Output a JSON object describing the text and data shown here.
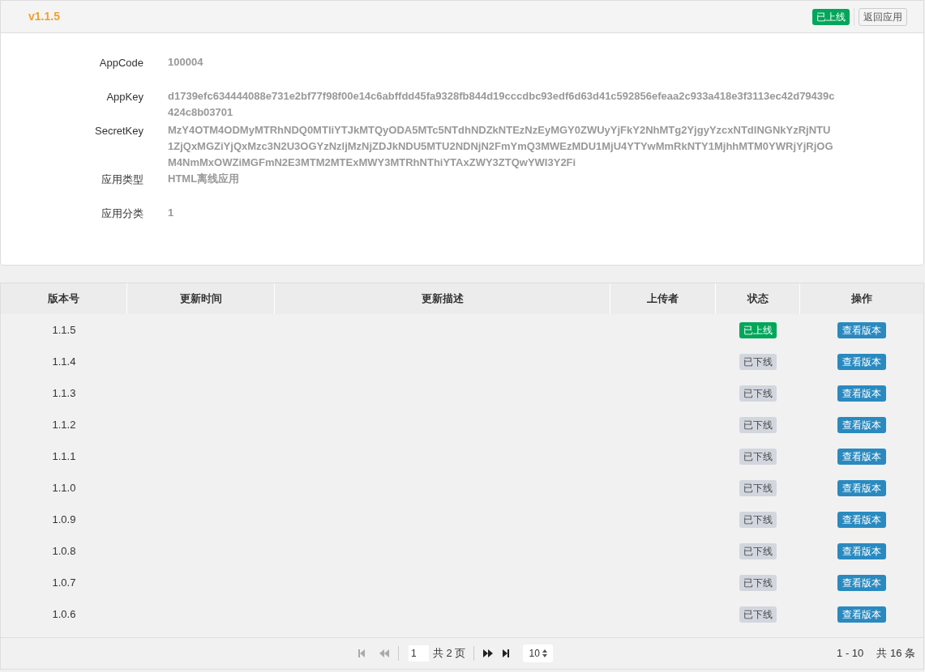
{
  "header": {
    "version": "v1.1.5",
    "status": {
      "label": "已上线",
      "kind": "online"
    },
    "back_button": "返回应用"
  },
  "fields": [
    {
      "label": "AppCode",
      "value": "100004"
    },
    {
      "label": "AppKey",
      "value": "d1739efc634444088e731e2bf77f98f00e14c6abffdd45fa9328fb844d19cccdbc93edf6d63d41c592856efeaa2c933a418e3f3113ec42d79439c424c8b03701"
    },
    {
      "label": "SecretKey",
      "value": "MzY4OTM4ODMyMTRhNDQ0MTliYTJkMTQyODA5MTc5NTdhNDZkNTEzNzEyMGY0ZWUyYjFkY2NhMTg2YjgyYzcxNTdlNGNkYzRjNTU1ZjQxMGZiYjQxMzc3N2U3OGYzNzljMzNjZDJkNDU5MTU2NDNjN2FmYmQ3MWEzMDU1MjU4YTYwMmRkNTY1MjhhMTM0YWRjYjRjOGM4NmMxOWZiMGFmN2E3MTM2MTExMWY3MTRhNThiYTAxZWY3ZTQwYWI3Y2Fi"
    },
    {
      "label": "应用类型",
      "value": "HTML离线应用"
    },
    {
      "label": "应用分类",
      "value": "1"
    }
  ],
  "table": {
    "columns": [
      "版本号",
      "更新时间",
      "更新描述",
      "上传者",
      "状态",
      "操作"
    ],
    "rows": [
      {
        "version": "1.1.5",
        "status": {
          "label": "已上线",
          "kind": "online"
        },
        "action": "查看版本"
      },
      {
        "version": "1.1.4",
        "status": {
          "label": "已下线",
          "kind": "offline"
        },
        "action": "查看版本"
      },
      {
        "version": "1.1.3",
        "status": {
          "label": "已下线",
          "kind": "offline"
        },
        "action": "查看版本"
      },
      {
        "version": "1.1.2",
        "status": {
          "label": "已下线",
          "kind": "offline"
        },
        "action": "查看版本"
      },
      {
        "version": "1.1.1",
        "status": {
          "label": "已下线",
          "kind": "offline"
        },
        "action": "查看版本"
      },
      {
        "version": "1.1.0",
        "status": {
          "label": "已下线",
          "kind": "offline"
        },
        "action": "查看版本"
      },
      {
        "version": "1.0.9",
        "status": {
          "label": "已下线",
          "kind": "offline"
        },
        "action": "查看版本"
      },
      {
        "version": "1.0.8",
        "status": {
          "label": "已下线",
          "kind": "offline"
        },
        "action": "查看版本"
      },
      {
        "version": "1.0.7",
        "status": {
          "label": "已下线",
          "kind": "offline"
        },
        "action": "查看版本"
      },
      {
        "version": "1.0.6",
        "status": {
          "label": "已下线",
          "kind": "offline"
        },
        "action": "查看版本"
      }
    ]
  },
  "pager": {
    "first_disabled": true,
    "prev_disabled": true,
    "next_disabled": false,
    "last_disabled": false,
    "page": "1",
    "total_pages": "共 2 页",
    "page_size": "10",
    "range": "1 - 10",
    "total": "共 16 条"
  }
}
